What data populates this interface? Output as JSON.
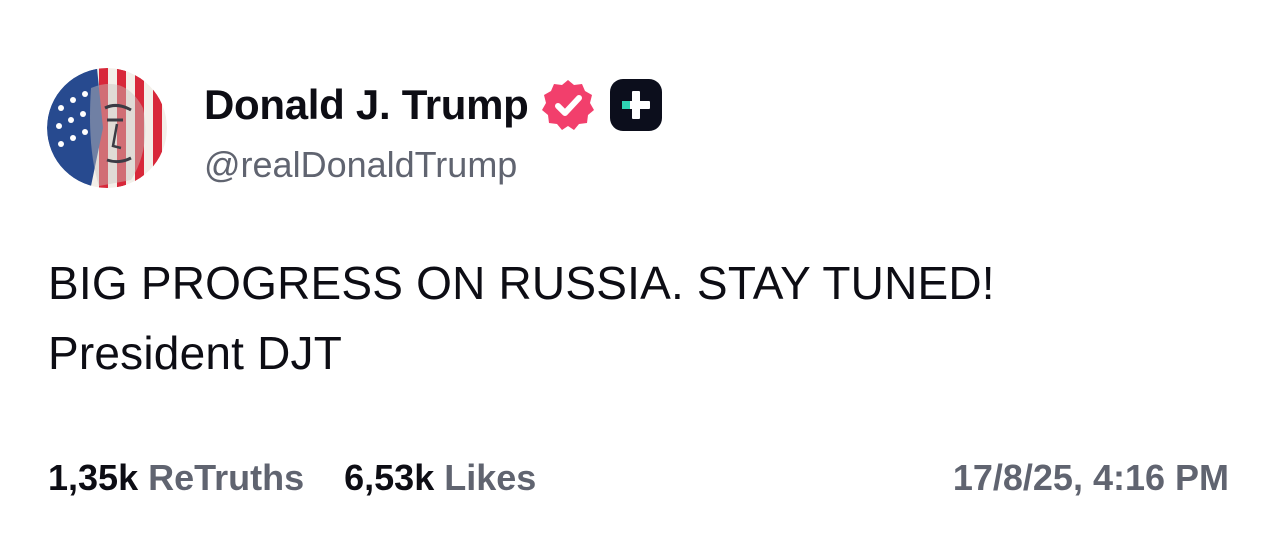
{
  "author": {
    "display_name": "Donald J. Trump",
    "handle": "@realDonaldTrump",
    "avatar_icon": "flag-portrait-avatar",
    "verified_icon": "verified-badge-icon",
    "verified_color": "#f23f6c",
    "platform_icon": "truth-social-plus-icon"
  },
  "post": {
    "lines": [
      "BIG PROGRESS ON RUSSIA. STAY TUNED!",
      "President DJT"
    ]
  },
  "stats": {
    "retruths_count": "1,35k",
    "retruths_label": "ReTruths",
    "likes_count": "6,53k",
    "likes_label": "Likes"
  },
  "timestamp": "17/8/25, 4:16 PM"
}
